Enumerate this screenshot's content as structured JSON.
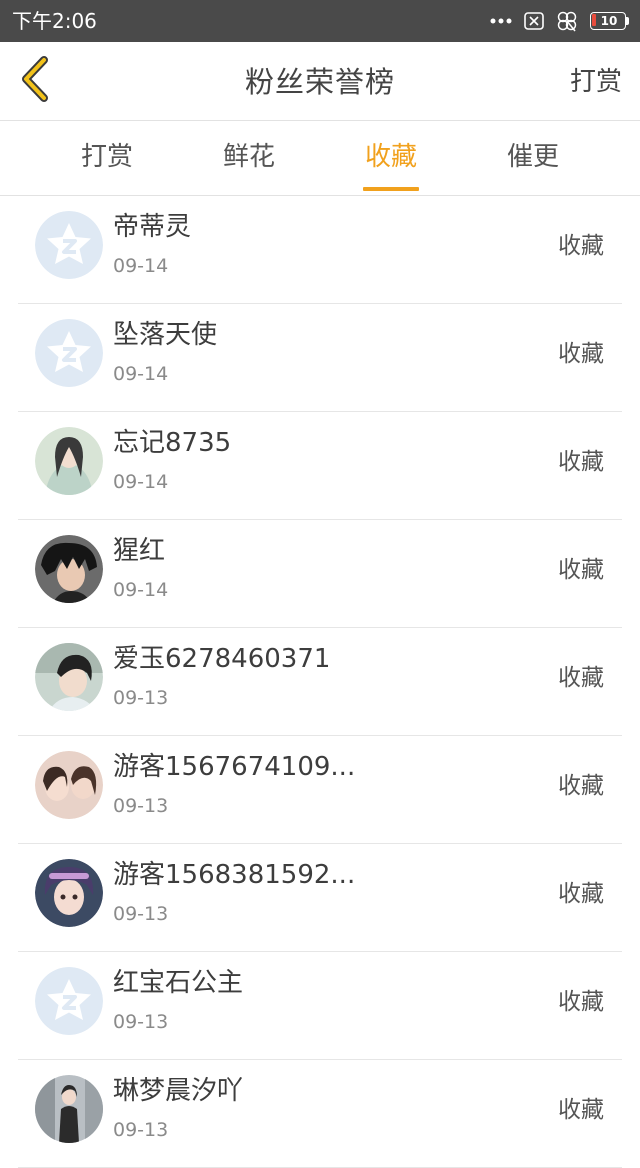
{
  "status_bar": {
    "time": "下午2:06",
    "battery_level": "10",
    "icons": [
      "more-dots-icon",
      "notification-box-icon",
      "clover-icon",
      "battery-icon"
    ]
  },
  "header": {
    "back_icon": "chevron-left-icon",
    "title": "粉丝荣誉榜",
    "action_label": "打赏"
  },
  "tabs": [
    {
      "label": "打赏",
      "active": false
    },
    {
      "label": "鲜花",
      "active": false
    },
    {
      "label": "收藏",
      "active": true
    },
    {
      "label": "催更",
      "active": false
    }
  ],
  "accent_color": "#f1a11d",
  "list": {
    "items": [
      {
        "name": "帝蒂灵",
        "date": "09-14",
        "action": "收藏",
        "avatar": "default-avatar-icon"
      },
      {
        "name": "坠落天使",
        "date": "09-14",
        "action": "收藏",
        "avatar": "default-avatar-icon"
      },
      {
        "name": "忘记8735",
        "date": "09-14",
        "action": "收藏",
        "avatar": "user-photo"
      },
      {
        "name": "猩红",
        "date": "09-14",
        "action": "收藏",
        "avatar": "user-photo"
      },
      {
        "name": "爱玉6278460371",
        "date": "09-13",
        "action": "收藏",
        "avatar": "user-photo"
      },
      {
        "name": "游客1567674109...",
        "date": "09-13",
        "action": "收藏",
        "avatar": "user-photo"
      },
      {
        "name": "游客1568381592...",
        "date": "09-13",
        "action": "收藏",
        "avatar": "user-photo"
      },
      {
        "name": "红宝石公主",
        "date": "09-13",
        "action": "收藏",
        "avatar": "default-avatar-icon"
      },
      {
        "name": "琳梦晨汐吖",
        "date": "09-13",
        "action": "收藏",
        "avatar": "user-photo"
      }
    ]
  }
}
